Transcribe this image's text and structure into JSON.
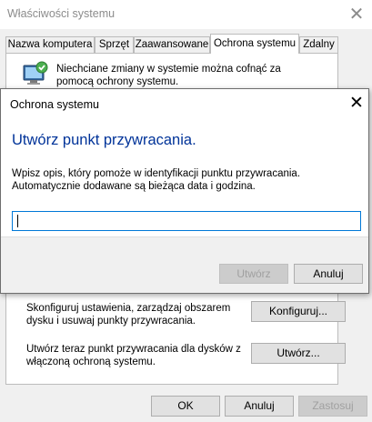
{
  "parent_window": {
    "title": "Właściwości systemu",
    "tabs": [
      {
        "label": "Nazwa komputera"
      },
      {
        "label": "Sprzęt"
      },
      {
        "label": "Zaawansowane"
      },
      {
        "label": "Ochrona systemu",
        "active": true
      },
      {
        "label": "Zdalny"
      }
    ],
    "intro_text": "Niechciane zmiany w systemie można cofnąć za pomocą ochrony systemu.",
    "configure_text": "Skonfiguruj ustawienia, zarządzaj obszarem dysku i usuwaj punkty przywracania.",
    "configure_button": "Konfiguruj...",
    "create_text": "Utwórz teraz punkt przywracania dla dysków z włączoną ochroną systemu.",
    "create_button": "Utwórz...",
    "ok_button": "OK",
    "cancel_button": "Anuluj",
    "apply_button": "Zastosuj"
  },
  "dialog": {
    "title": "Ochrona systemu",
    "heading": "Utwórz punkt przywracania.",
    "description": "Wpisz opis, który pomoże w identyfikacji punktu przywracania. Automatycznie dodawane są bieżąca data i godzina.",
    "input_value": "",
    "create_button": "Utwórz",
    "cancel_button": "Anuluj"
  },
  "colors": {
    "heading_blue": "#003399",
    "focus_border": "#0078d7",
    "disabled_text": "#a0a0a0"
  }
}
